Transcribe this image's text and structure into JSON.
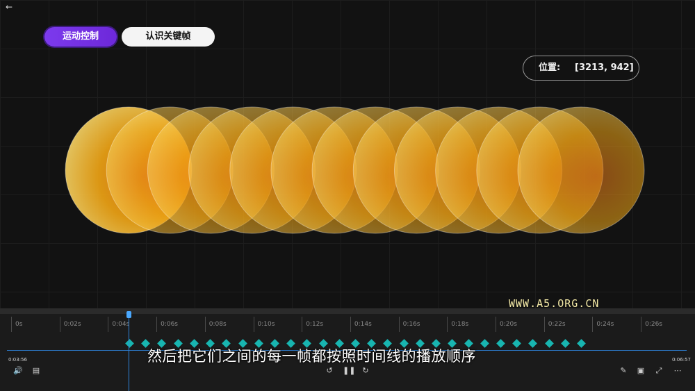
{
  "window": {
    "back_icon": "back-arrow-icon"
  },
  "tabs": [
    {
      "label": "运动控制",
      "active": true,
      "color": "#7c3aed"
    },
    {
      "label": "认识关键帧",
      "active": false
    }
  ],
  "position": {
    "label": "位置:",
    "value": "[3213, 942]"
  },
  "circles": {
    "count": 12,
    "colors": {
      "core": "#f0a400",
      "edge": "#e86d10",
      "highlight": "#ffe9a8"
    }
  },
  "watermark": "WWW.A5.ORG.CN",
  "timeline": {
    "ticks": [
      "0s",
      "0:02s",
      "0:04s",
      "0:06s",
      "0:08s",
      "0:10s",
      "0:12s",
      "0:14s",
      "0:16s",
      "0:18s",
      "0:20s",
      "0:22s",
      "0:24s",
      "0:26s"
    ],
    "playhead_color": "#4aa8ff",
    "keyframe_color": "#18b5b0",
    "keyframe_count": 29
  },
  "player": {
    "current_time": "0:03:56",
    "duration": "0:06:57",
    "subtitle": "然后把它们之间的每一帧都按照时间线的播放顺序",
    "controls": {
      "volume": "volume-icon",
      "captions": "captions-icon",
      "rewind": "rewind-10-icon",
      "pause": "pause-icon",
      "forward": "forward-30-icon",
      "pen": "pen-icon",
      "miniplayer": "miniplayer-icon",
      "collapse": "collapse-icon",
      "more": "more-icon"
    }
  }
}
